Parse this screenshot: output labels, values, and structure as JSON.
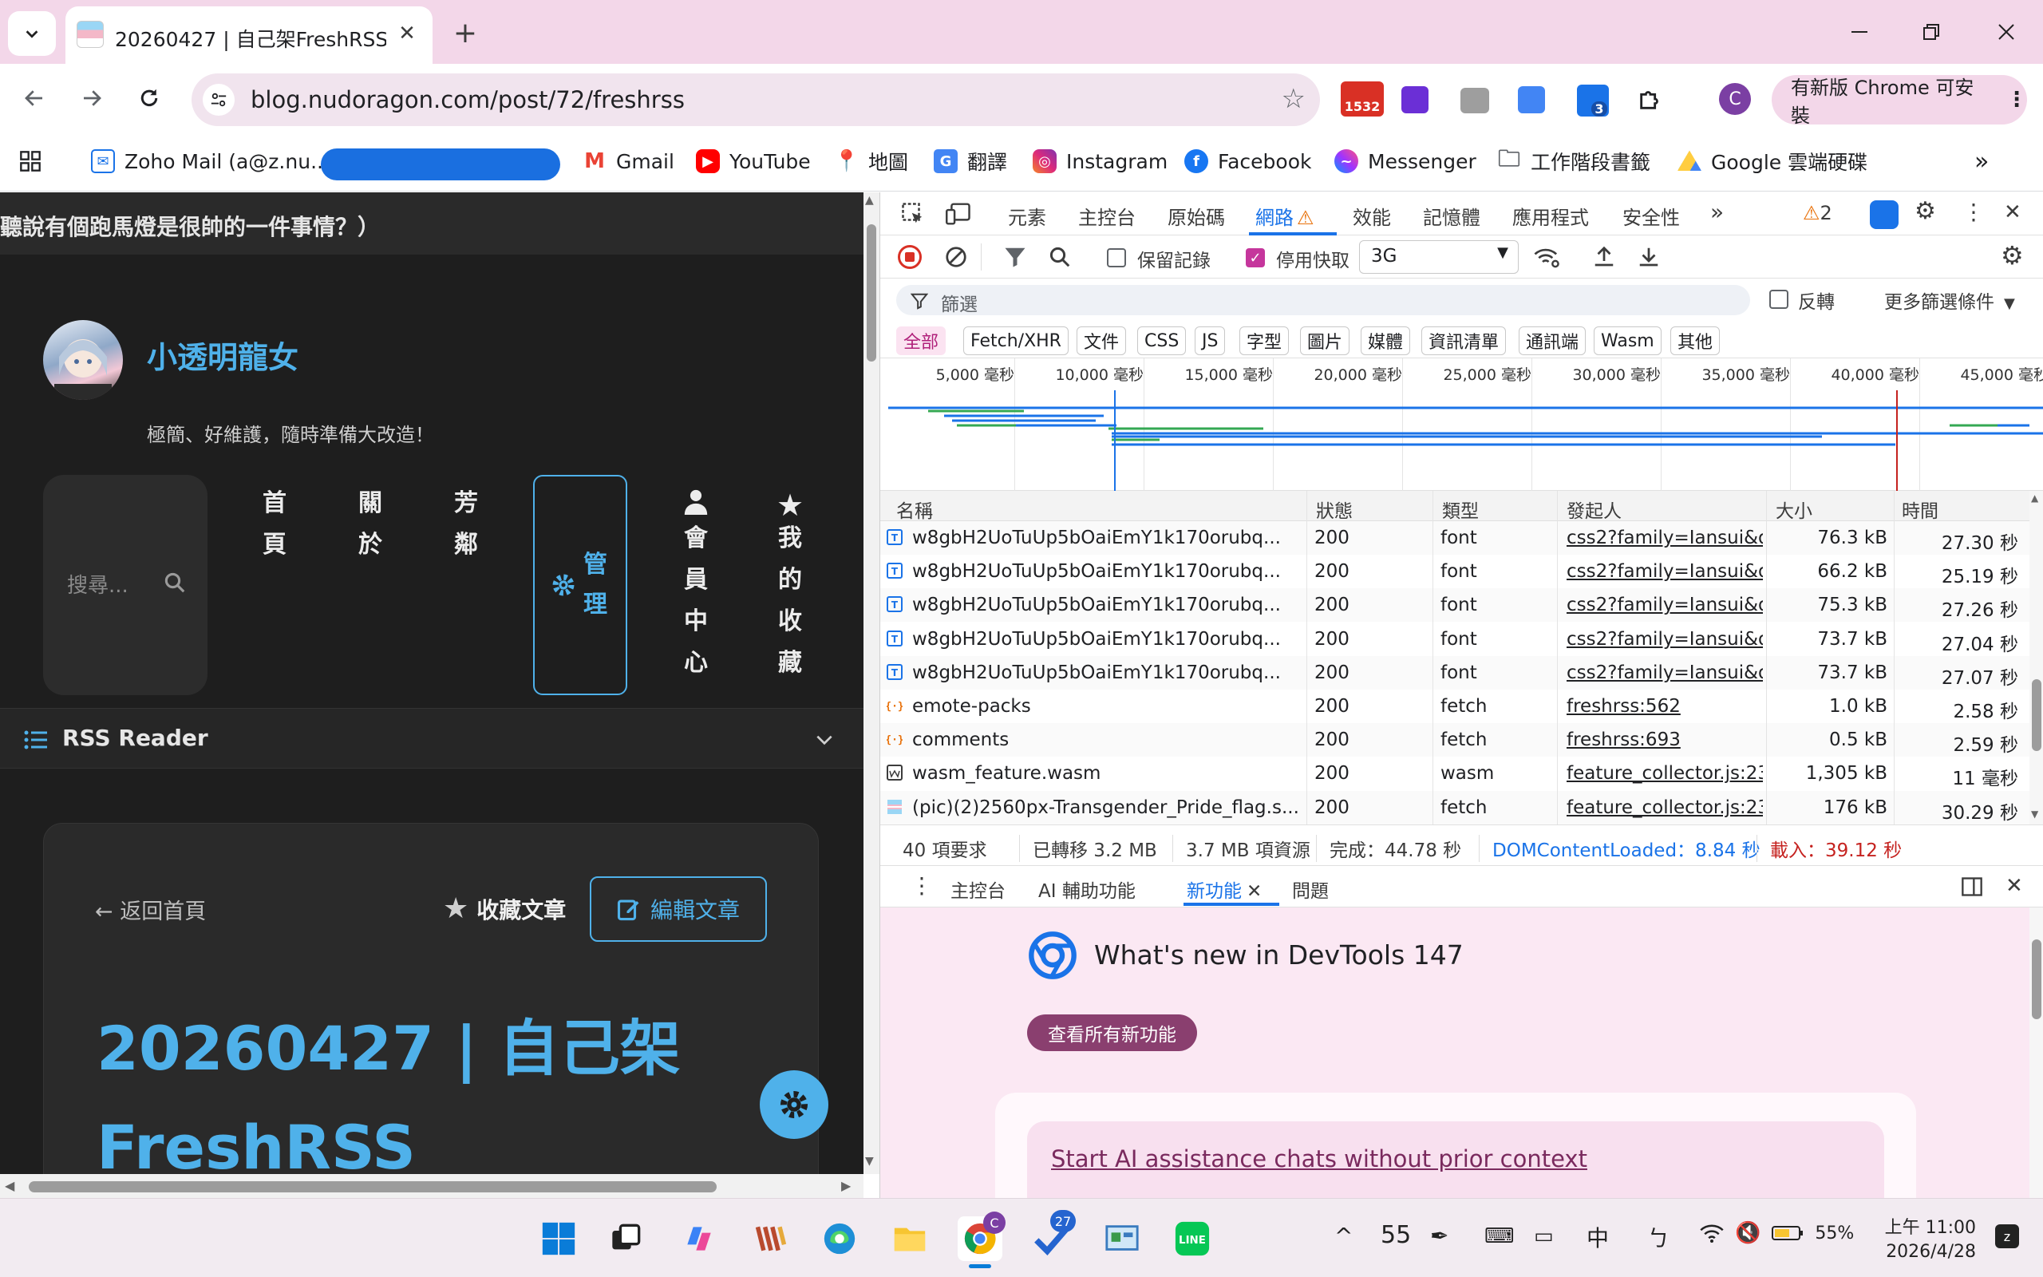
{
  "browser": {
    "tab_title": "20260427 | 自己架FreshRSS -",
    "url": "blog.nudoragon.com/post/72/freshrss",
    "ext_badge_count": "1532",
    "ext_badge_small": "3",
    "profile_initial": "C",
    "update_label": "有新版 Chrome 可安裝"
  },
  "bookmarks": [
    {
      "label": "Zoho Mail (a@z.nu..."
    },
    {
      "label": "Gmail"
    },
    {
      "label": "YouTube"
    },
    {
      "label": "地圖"
    },
    {
      "label": "翻譯"
    },
    {
      "label": "Instagram"
    },
    {
      "label": "Facebook"
    },
    {
      "label": "Messenger"
    },
    {
      "label": "工作階段書籤"
    },
    {
      "label": "Google 雲端硬碟"
    }
  ],
  "site": {
    "marquee": "聽說有個跑馬燈是很帥的一件事情？）",
    "name": "小透明龍女",
    "tagline": "極簡、好維護，隨時準備大改造！",
    "search_placeholder": "搜尋...",
    "nav": [
      "首頁",
      "關於",
      "芳鄰"
    ],
    "admin_label": "管理",
    "member_label": "會員中心",
    "favorites_label": "我的收藏",
    "rss_label": "RSS Reader",
    "back_label": "← 返回首頁",
    "fav_post_label": "收藏文章",
    "edit_post_label": "編輯文章",
    "post_title": "20260427 | 自己架 FreshRSS"
  },
  "devtools": {
    "tabs": [
      "元素",
      "主控台",
      "原始碼",
      "網路",
      "效能",
      "記憶體",
      "應用程式",
      "安全性"
    ],
    "issues_count": "2",
    "preserve_log": "保留記錄",
    "disable_cache": "停用快取",
    "throttle": "3G",
    "filter_placeholder": "篩選",
    "invert_label": "反轉",
    "more_filters": "更多篩選條件",
    "type_filters": [
      "全部",
      "Fetch/XHR",
      "文件",
      "CSS",
      "JS",
      "字型",
      "圖片",
      "媒體",
      "資訊清單",
      "通訊端",
      "Wasm",
      "其他"
    ],
    "timeline_ticks": [
      "5,000 毫秒",
      "10,000 毫秒",
      "15,000 毫秒",
      "20,000 毫秒",
      "25,000 毫秒",
      "30,000 毫秒",
      "35,000 毫秒",
      "40,000 毫秒",
      "45,000 毫秒"
    ],
    "columns": [
      "名稱",
      "狀態",
      "類型",
      "發起人",
      "大小",
      "時間"
    ],
    "rows": [
      {
        "name": "w8gbH2UoTuUp5bOaiEmY1k170orubq...",
        "status": "200",
        "type": "font",
        "initiator": "css2?family=Iansui&di",
        "size": "76.3 kB",
        "time": "27.30 秒",
        "icon": "font"
      },
      {
        "name": "w8gbH2UoTuUp5bOaiEmY1k170orubq...",
        "status": "200",
        "type": "font",
        "initiator": "css2?family=Iansui&di",
        "size": "66.2 kB",
        "time": "25.19 秒",
        "icon": "font"
      },
      {
        "name": "w8gbH2UoTuUp5bOaiEmY1k170orubq...",
        "status": "200",
        "type": "font",
        "initiator": "css2?family=Iansui&di",
        "size": "75.3 kB",
        "time": "27.26 秒",
        "icon": "font"
      },
      {
        "name": "w8gbH2UoTuUp5bOaiEmY1k170orubq...",
        "status": "200",
        "type": "font",
        "initiator": "css2?family=Iansui&di",
        "size": "73.7 kB",
        "time": "27.04 秒",
        "icon": "font"
      },
      {
        "name": "w8gbH2UoTuUp5bOaiEmY1k170orubq...",
        "status": "200",
        "type": "font",
        "initiator": "css2?family=Iansui&di",
        "size": "73.7 kB",
        "time": "27.07 秒",
        "icon": "font"
      },
      {
        "name": "emote-packs",
        "status": "200",
        "type": "fetch",
        "initiator": "freshrss:562",
        "size": "1.0 kB",
        "time": "2.58 秒",
        "icon": "fetch"
      },
      {
        "name": "comments",
        "status": "200",
        "type": "fetch",
        "initiator": "freshrss:693",
        "size": "0.5 kB",
        "time": "2.59 秒",
        "icon": "fetch"
      },
      {
        "name": "wasm_feature.wasm",
        "status": "200",
        "type": "wasm",
        "initiator": "feature_collector.js:23",
        "size": "1,305 kB",
        "time": "11 毫秒",
        "icon": "wasm"
      },
      {
        "name": "(pic)(2)2560px-Transgender_Pride_flag.s...",
        "status": "200",
        "type": "fetch",
        "initiator": "feature_collector.js:23",
        "size": "176 kB",
        "time": "30.29 秒",
        "icon": "img"
      }
    ],
    "summary": {
      "requests": "40 項要求",
      "transferred": "已轉移 3.2 MB",
      "resources": "3.7 MB 項資源",
      "finish": "完成：44.78 秒",
      "dcl": "DOMContentLoaded：8.84 秒",
      "load": "載入：39.12 秒"
    },
    "drawer_tabs": [
      "主控台",
      "AI 輔助功能",
      "新功能",
      "問題"
    ],
    "whatsnew_title": "What's new in DevTools 147",
    "whatsnew_button": "查看所有新功能",
    "whatsnew_link": "Start AI assistance chats without prior context"
  },
  "taskbar": {
    "edge_badge": "C",
    "todo_badge": "27",
    "weather_temp": "55",
    "ime": "中",
    "battery": "55%",
    "time": "上午 11:00",
    "date": "2026/4/28"
  },
  "colors": {
    "accent": "#4fb1ea",
    "chrome_pink": "#f3d7e9",
    "devtools_blue": "#1a73e8"
  }
}
